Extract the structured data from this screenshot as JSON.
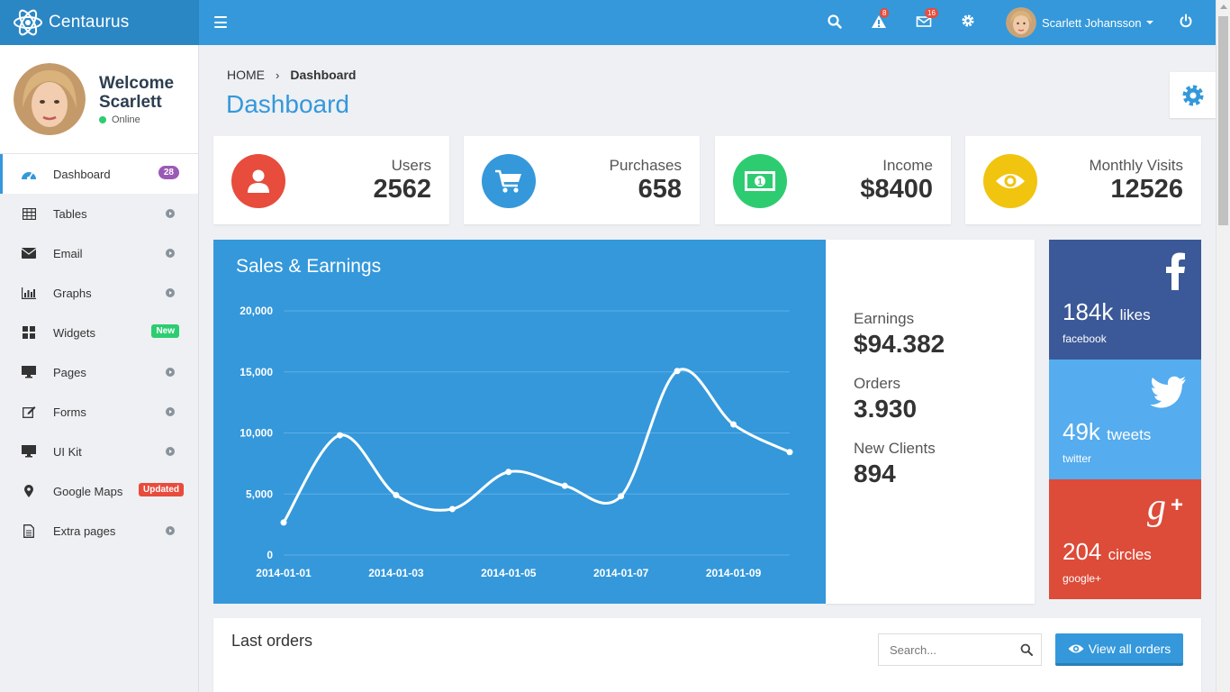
{
  "app": {
    "name": "Centaurus"
  },
  "topbar": {
    "alerts_count": "8",
    "messages_count": "16",
    "user_name": "Scarlett Johansson"
  },
  "sidebar": {
    "welcome": "Welcome",
    "user_first": "Scarlett",
    "status": "Online",
    "items": [
      {
        "label": "Dashboard",
        "icon": "dashboard-icon",
        "badge": "28"
      },
      {
        "label": "Tables",
        "icon": "table-icon"
      },
      {
        "label": "Email",
        "icon": "envelope-icon"
      },
      {
        "label": "Graphs",
        "icon": "bar-chart-icon"
      },
      {
        "label": "Widgets",
        "icon": "widgets-icon",
        "badge": "New"
      },
      {
        "label": "Pages",
        "icon": "desktop-icon"
      },
      {
        "label": "Forms",
        "icon": "edit-icon"
      },
      {
        "label": "UI Kit",
        "icon": "desktop-icon"
      },
      {
        "label": "Google Maps",
        "icon": "map-marker-icon",
        "badge": "Updated"
      },
      {
        "label": "Extra pages",
        "icon": "file-icon"
      }
    ]
  },
  "breadcrumb": {
    "home": "HOME",
    "separator": "›",
    "current": "Dashboard"
  },
  "page": {
    "title": "Dashboard"
  },
  "stats": [
    {
      "label": "Users",
      "value": "2562",
      "color": "#e74c3c",
      "icon": "user-icon"
    },
    {
      "label": "Purchases",
      "value": "658",
      "color": "#3498db",
      "icon": "cart-icon"
    },
    {
      "label": "Income",
      "value": "$8400",
      "color": "#2ecc71",
      "icon": "money-icon"
    },
    {
      "label": "Monthly Visits",
      "value": "12526",
      "color": "#f1c40f",
      "icon": "eye-icon"
    }
  ],
  "summary": {
    "earnings_label": "Earnings",
    "earnings_value": "$94.382",
    "orders_label": "Orders",
    "orders_value": "3.930",
    "clients_label": "New Clients",
    "clients_value": "894"
  },
  "social": {
    "facebook": {
      "count": "184k",
      "unit": "likes",
      "network": "facebook",
      "color": "#3b5998"
    },
    "twitter": {
      "count": "49k",
      "unit": "tweets",
      "network": "twitter",
      "color": "#55acee"
    },
    "google": {
      "count": "204",
      "unit": "circles",
      "network": "google+",
      "color": "#dd4b39"
    }
  },
  "orders": {
    "title": "Last orders",
    "search_placeholder": "Search...",
    "view_all": "View all orders"
  },
  "chart_data": {
    "type": "line",
    "title": "Sales & Earnings",
    "x": [
      "2014-01-01",
      "2014-01-02",
      "2014-01-03",
      "2014-01-04",
      "2014-01-05",
      "2014-01-06",
      "2014-01-07",
      "2014-01-08",
      "2014-01-09",
      "2014-01-10"
    ],
    "x_tick_labels": [
      "2014-01-01",
      "2014-01-03",
      "2014-01-05",
      "2014-01-07",
      "2014-01-09"
    ],
    "values": [
      2666,
      9810,
      4912,
      3767,
      6810,
      5670,
      4820,
      15073,
      10697,
      8432
    ],
    "y_ticks": [
      "0",
      "5,000",
      "10,000",
      "15,000",
      "20,000"
    ],
    "ylim": [
      0,
      20000
    ],
    "grid": true,
    "colors": {
      "background": "#3498db",
      "line": "#ffffff",
      "grid": "#5eaee6"
    }
  }
}
